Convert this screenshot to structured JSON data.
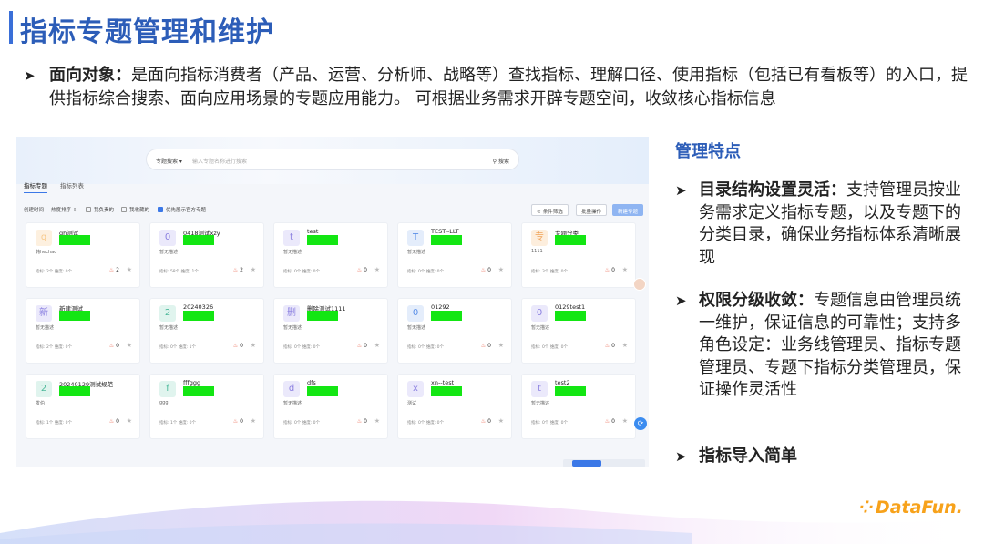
{
  "slide": {
    "title": "指标专题管理和维护",
    "intro": {
      "label": "面向对象：",
      "text": "是面向指标消费者（产品、运营、分析师、战略等）查找指标、理解口径、使用指标（包括已有看板等）的入口，提供指标综合搜索、面向应用场景的专题应用能力。 可根据业务需求开辟专题空间，收敛核心指标信息"
    },
    "side": {
      "heading": "管理特点",
      "items": [
        {
          "label": "目录结构设置灵活：",
          "text": "支持管理员按业务需求定义指标专题，以及专题下的分类目录，确保业务指标体系清晰展现"
        },
        {
          "label": "权限分级收敛：",
          "text": "专题信息由管理员统一维护，保证信息的可靠性；支持多角色设定：业务线管理员、指标专题管理员、专题下指标分类管理员，保证操作灵活性"
        },
        {
          "label": "指标导入简单",
          "text": ""
        }
      ]
    },
    "logo": "DataFun."
  },
  "app": {
    "search": {
      "select_label": "专题搜索 ▾",
      "placeholder": "输入专题名称进行搜索",
      "button_label": "搜索"
    },
    "tabs": [
      "指标专题",
      "指标列表"
    ],
    "filters": {
      "sort_time": "创建时间",
      "sort_hot": "热度排序 ⇩",
      "check1": "我负责的",
      "check2": "我收藏的",
      "check3": "优先展示官方专题",
      "btn_filter": "条件筛选",
      "btn_batch": "批量操作",
      "btn_new": "新建专题"
    },
    "cards": [
      {
        "avatar": "g",
        "color": "#f7c98b",
        "bg": "#fdf0df",
        "name": "gh测试",
        "desc": "韩hechao",
        "stats": "指标: 2个  维度: 0个",
        "hot": "2"
      },
      {
        "avatar": "0",
        "color": "#8a7fe0",
        "bg": "#ebe9fb",
        "name": "0418测试xzy",
        "desc": "暂无描述",
        "stats": "指标: 58个  维度: 1个",
        "hot": "2"
      },
      {
        "avatar": "t",
        "color": "#8a7fe0",
        "bg": "#ebe9fb",
        "name": "test",
        "desc": "暂无描述",
        "stats": "指标: 0个  维度: 0个",
        "hot": "0"
      },
      {
        "avatar": "T",
        "color": "#5a8fe8",
        "bg": "#e4edfb",
        "name": "TEST--LLT",
        "desc": "暂无描述",
        "stats": "指标: 0个  维度: 0个",
        "hot": "0"
      },
      {
        "avatar": "专",
        "color": "#f0a45a",
        "bg": "#fdeedd",
        "name": "专题分类",
        "desc": "1111",
        "stats": "指标: 3个  维度: 0个",
        "hot": "0"
      },
      {
        "avatar": "新",
        "color": "#8a7fe0",
        "bg": "#ebe9fb",
        "name": "新建测试",
        "desc": "暂无描述",
        "stats": "指标: 2个  维度: 0个",
        "hot": "0"
      },
      {
        "avatar": "2",
        "color": "#4cb89a",
        "bg": "#e0f4ee",
        "name": "20240326",
        "desc": "暂无描述",
        "stats": "指标: 0个  维度: 1个",
        "hot": "0"
      },
      {
        "avatar": "删",
        "color": "#8a7fe0",
        "bg": "#ebe9fb",
        "name": "删除测试1111",
        "desc": "暂无描述",
        "stats": "指标: 0个  维度: 0个",
        "hot": "0"
      },
      {
        "avatar": "0",
        "color": "#5a8fe8",
        "bg": "#e4edfb",
        "name": "01292",
        "desc": "暂无描述",
        "stats": "指标: 0个  维度: 0个",
        "hot": "0"
      },
      {
        "avatar": "0",
        "color": "#8a7fe0",
        "bg": "#ebe9fb",
        "name": "0129test1",
        "desc": "暂无描述",
        "stats": "指标: 0个  维度: 0个",
        "hot": "0"
      },
      {
        "avatar": "2",
        "color": "#4cb89a",
        "bg": "#e0f4ee",
        "name": "20240129测试规范",
        "desc": "发伯",
        "stats": "指标: 1个  维度: 0个",
        "hot": "0"
      },
      {
        "avatar": "f",
        "color": "#4cb89a",
        "bg": "#e0f4ee",
        "name": "fffggg",
        "desc": "ggg",
        "stats": "指标: 1个  维度: 0个",
        "hot": "0"
      },
      {
        "avatar": "d",
        "color": "#8a7fe0",
        "bg": "#ebe9fb",
        "name": "dfs",
        "desc": "暂无描述",
        "stats": "指标: 0个  维度: 0个",
        "hot": "0"
      },
      {
        "avatar": "x",
        "color": "#8a7fe0",
        "bg": "#ebe9fb",
        "name": "xn--test",
        "desc": "测试",
        "stats": "指标: 0个  维度: 0个",
        "hot": "0"
      },
      {
        "avatar": "t",
        "color": "#8a7fe0",
        "bg": "#ebe9fb",
        "name": "test2",
        "desc": "暂无描述",
        "stats": "指标: 0个  维度: 0个",
        "hot": "0"
      }
    ]
  }
}
